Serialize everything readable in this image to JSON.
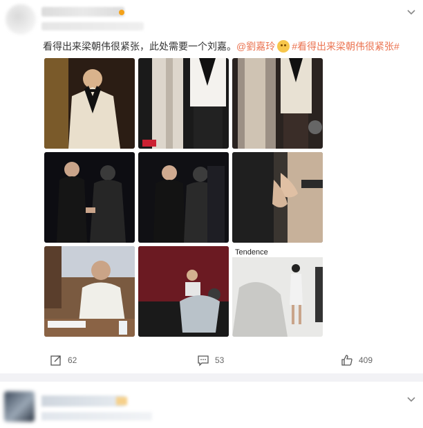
{
  "post": {
    "author_name": "",
    "text_main": "看得出来梁朝伟很紧张，此处需要一个刘嘉。",
    "mention": "@劉嘉玲",
    "hashtag": "#看得出来梁朝伟很紧张#",
    "emoji": "doge-emoji",
    "images": [
      {
        "icon": "photo-white-tux-portrait"
      },
      {
        "icon": "photo-two-suits-red-carpet"
      },
      {
        "icon": "photo-two-suits-blurred"
      },
      {
        "icon": "photo-couple-dark-event"
      },
      {
        "icon": "photo-couple-dark-event-2"
      },
      {
        "icon": "photo-holding-hands-closeup"
      },
      {
        "icon": "photo-seated-meeting"
      },
      {
        "icon": "photo-stage-bowing"
      },
      {
        "icon": "photo-tendence-backdrop"
      }
    ],
    "actions": {
      "share_count": "62",
      "comment_count": "53",
      "like_count": "409"
    }
  },
  "colors": {
    "link": "#eb7350",
    "divider": "#f2f2f5",
    "text": "#333333",
    "muted": "#666666"
  }
}
